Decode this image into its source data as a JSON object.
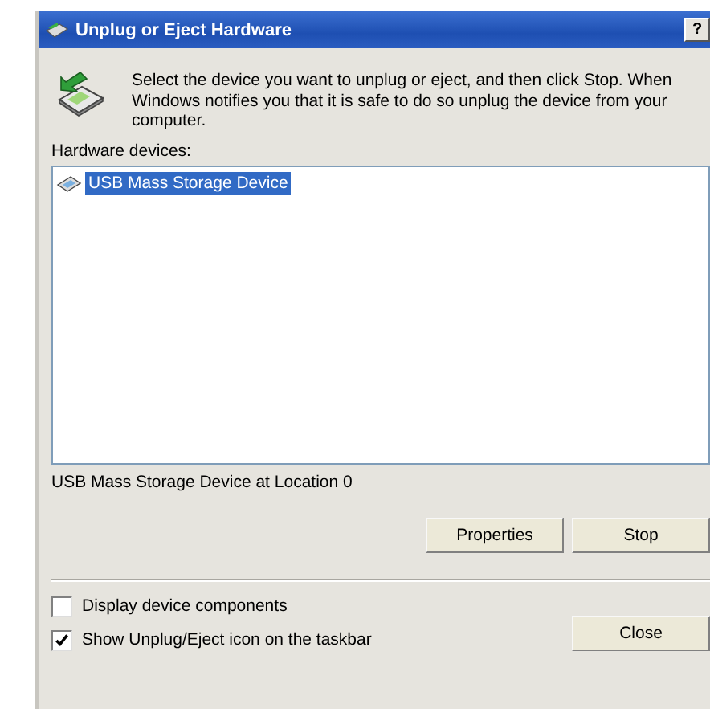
{
  "window": {
    "title": "Unplug or Eject Hardware",
    "help_button": "?"
  },
  "instructions": "Select the device you want to unplug or eject, and then click Stop. When Windows notifies you that it is safe to do so unplug the device from your computer.",
  "list_label": "Hardware devices:",
  "devices": [
    {
      "name": "USB Mass Storage Device",
      "selected": true
    }
  ],
  "device_status": "USB Mass Storage Device at Location 0",
  "buttons": [
    {
      "label": "Properties"
    },
    {
      "label": "Stop"
    }
  ],
  "options": [
    {
      "label": "Display device components",
      "checked": false
    },
    {
      "label": "Show Unplug/Eject icon on the taskbar",
      "checked": true
    }
  ],
  "close_button": "Close"
}
